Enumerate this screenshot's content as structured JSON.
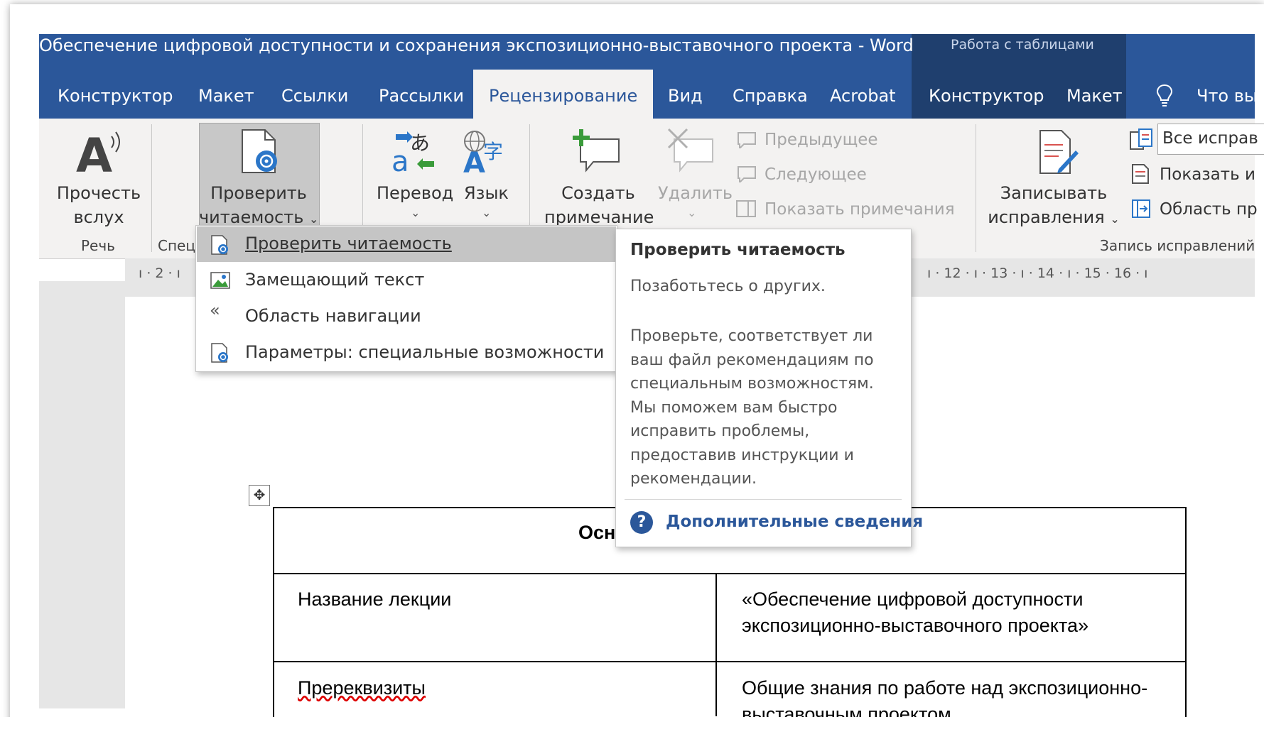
{
  "window": {
    "title": "Обеспечение цифровой доступности и сохранения экспозиционно-выставочного проекта  -  Word",
    "context_title": "Работа с таблицами"
  },
  "tabs": [
    {
      "label": "Конструктор"
    },
    {
      "label": "Макет"
    },
    {
      "label": "Ссылки"
    },
    {
      "label": "Рассылки"
    },
    {
      "label": "Рецензирование",
      "active": true
    },
    {
      "label": "Вид"
    },
    {
      "label": "Справка"
    },
    {
      "label": "Acrobat"
    },
    {
      "label": "Конструктор"
    },
    {
      "label": "Макет"
    }
  ],
  "tell_me": "Что вы",
  "ribbon": {
    "read_aloud": {
      "line1": "Прочесть",
      "line2": "вслух"
    },
    "speech_group": "Речь",
    "check_access": {
      "line1": "Проверить",
      "line2": "читаемость"
    },
    "accessibility_group": "Специ",
    "translate": "Перевод",
    "language": "Язык",
    "new_comment": {
      "line1": "Создать",
      "line2": "примечание"
    },
    "delete": "Удалить",
    "previous": "Предыдущее",
    "next": "Следующее",
    "show_comments": "Показать примечания",
    "track_changes": {
      "line1": "Записывать",
      "line2": "исправления"
    },
    "markup_select": "Все исправ",
    "show_markup": "Показать и",
    "reviewing_pane": "Область пр",
    "tracking_group": "Запись исправлений"
  },
  "ruler": {
    "left_marks": [
      "2"
    ],
    "right_marks": [
      "12",
      "13",
      "14",
      "15",
      "16"
    ]
  },
  "dropdown": {
    "items": [
      {
        "label": "Проверить читаемость",
        "icon": "check-accessibility-icon",
        "highlighted": true
      },
      {
        "label": "Замещающий текст",
        "icon": "alt-text-icon"
      },
      {
        "label": "Область навигации",
        "icon": "navigation-pane-icon"
      },
      {
        "label": "Параметры: специальные возможности",
        "icon": "accessibility-options-icon"
      }
    ]
  },
  "tooltip": {
    "title": "Проверить читаемость",
    "subtitle": "Позаботьтесь о других.",
    "body": "Проверьте, соответствует ли ваш файл рекомендациям по специальным возможностям. Мы поможем вам быстро исправить проблемы, предоставив инструкции и рекомендации.",
    "link": "Дополнительные сведения"
  },
  "document": {
    "table_header": "Осно",
    "rows": [
      {
        "label": "Название лекции",
        "value": "«Обеспечение цифровой доступности экспозиционно-выставочного проекта»"
      },
      {
        "label": "Пререквизиты",
        "value": "Общие знания по работе над экспозиционно-выставочным проектом"
      }
    ]
  },
  "colors": {
    "word_blue": "#2b579a",
    "table_tools": "#1f3f6e",
    "ribbon": "#f3f2f1"
  }
}
